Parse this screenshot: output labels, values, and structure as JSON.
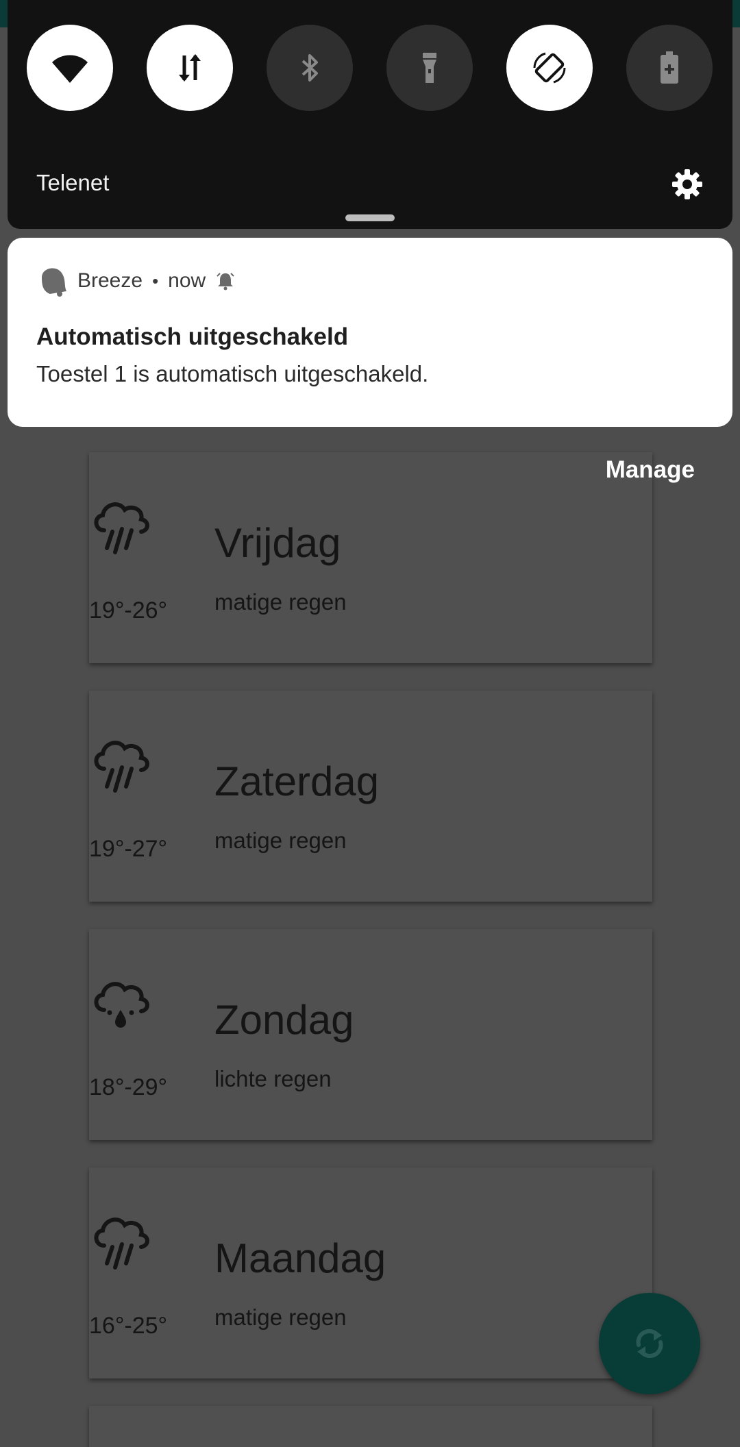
{
  "quick_settings": {
    "tiles": [
      {
        "icon": "wifi-icon",
        "state": "on"
      },
      {
        "icon": "mobile-data-icon",
        "state": "on"
      },
      {
        "icon": "bluetooth-icon",
        "state": "off"
      },
      {
        "icon": "flashlight-icon",
        "state": "off"
      },
      {
        "icon": "auto-rotate-icon",
        "state": "on"
      },
      {
        "icon": "battery-saver-icon",
        "state": "off"
      }
    ],
    "carrier": "Telenet"
  },
  "notification": {
    "app": "Breeze",
    "separator": "•",
    "time": "now",
    "title": "Automatisch uitgeschakeld",
    "text": "Toestel 1 is automatisch uitgeschakeld."
  },
  "manage_label": "Manage",
  "forecast": [
    {
      "day": "Vrijdag",
      "desc": "matige regen",
      "temp": "19°-26°",
      "icon": "heavy-rain-icon"
    },
    {
      "day": "Zaterdag",
      "desc": "matige regen",
      "temp": "19°-27°",
      "icon": "heavy-rain-icon"
    },
    {
      "day": "Zondag",
      "desc": "lichte regen",
      "temp": "18°-29°",
      "icon": "light-rain-icon"
    },
    {
      "day": "Maandag",
      "desc": "matige regen",
      "temp": "16°-25°",
      "icon": "heavy-rain-icon"
    }
  ],
  "colors": {
    "accent": "#083c37",
    "shade": "#121212"
  }
}
